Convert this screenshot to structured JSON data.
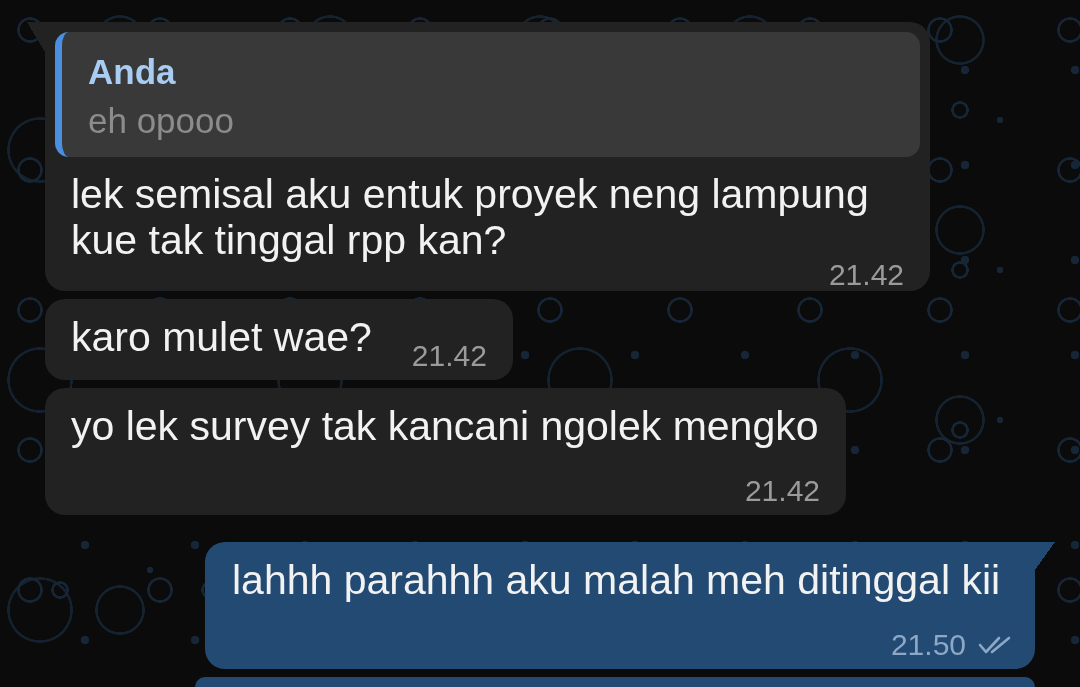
{
  "messages": [
    {
      "kind": "incoming",
      "tail": true,
      "reply": {
        "author": "Anda",
        "text": "eh opooo"
      },
      "text": "lek semisal aku entuk proyek neng lampung kue tak tinggal rpp kan?",
      "time": "21.42"
    },
    {
      "kind": "incoming",
      "tail": false,
      "text": "karo mulet wae?",
      "time": "21.42"
    },
    {
      "kind": "incoming",
      "tail": false,
      "text": "yo lek survey tak kancani ngolek mengko",
      "time": "21.42"
    },
    {
      "kind": "outgoing",
      "tail": true,
      "text": "lahhh parahhh aku malah meh ditinggal kii",
      "time": "21.50",
      "read": true
    },
    {
      "kind": "outgoing",
      "tail": false
    }
  ]
}
